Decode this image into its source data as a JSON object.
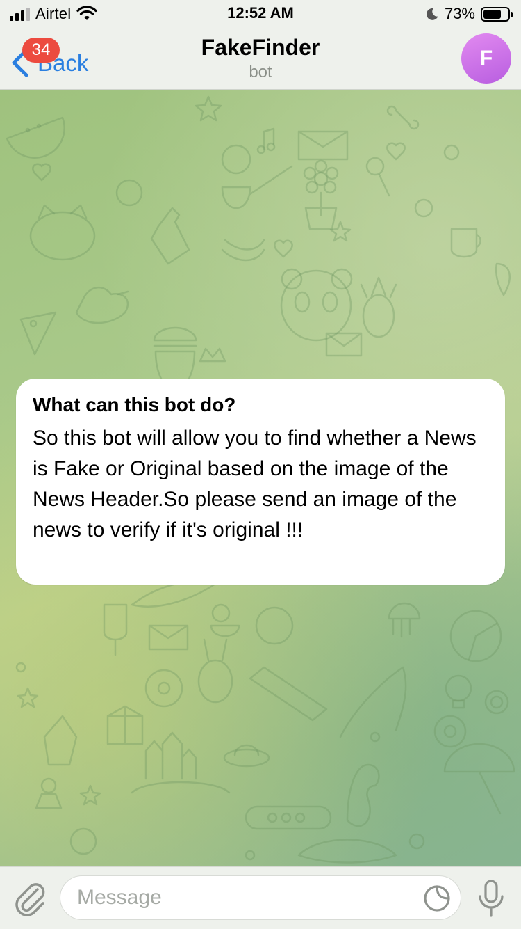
{
  "status_bar": {
    "carrier": "Airtel",
    "time": "12:52 AM",
    "battery_percent": "73%",
    "battery_level": 0.73,
    "icons": [
      "signal-icon",
      "wifi-icon",
      "moon-icon",
      "battery-icon"
    ]
  },
  "nav": {
    "back_label": "Back",
    "unread_count": "34",
    "title": "FakeFinder",
    "subtitle": "bot",
    "avatar_letter": "F",
    "avatar_color": "#c86de8"
  },
  "message": {
    "title": "What can this bot do?",
    "body": "So this bot will allow you to find whether a News is Fake or Original based on the image of the News Header.So please send an image of the news to verify if it's original !!!"
  },
  "composer": {
    "placeholder": "Message",
    "value": "",
    "icons": [
      "paperclip-icon",
      "sticker-icon",
      "microphone-icon"
    ]
  },
  "colors": {
    "accent": "#2a7fe0",
    "badge": "#ec4b3f",
    "chat_background": "#a9c98a"
  }
}
